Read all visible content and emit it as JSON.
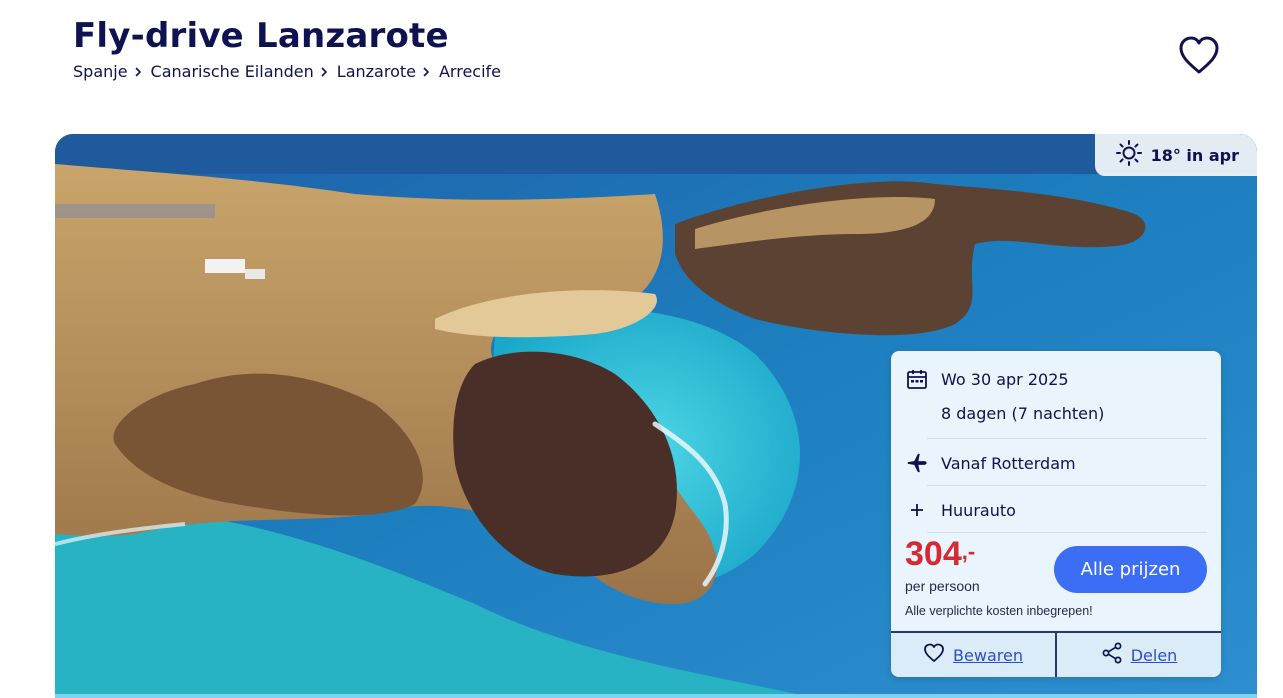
{
  "header": {
    "title": "Fly-drive Lanzarote",
    "breadcrumb": [
      "Spanje",
      "Canarische Eilanden",
      "Lanzarote",
      "Arrecife"
    ]
  },
  "hero": {
    "weather": "18° in apr",
    "image_subject": "Aerial coastline with turquoise sea and cliffs"
  },
  "card": {
    "date": "Wo 30 apr 2025",
    "duration": "8 dagen (7 nachten)",
    "departure": "Vanaf Rotterdam",
    "extra": "Huurauto",
    "price_main": "304",
    "price_suffix": ",-",
    "price_unit": "per persoon",
    "costs_note": "Alle verplichte kosten inbegrepen!",
    "cta": "Alle prijzen",
    "save": "Bewaren",
    "share": "Delen"
  },
  "colors": {
    "title": "#0f1250",
    "price": "#d52a34",
    "cta": "#3b6df5",
    "link": "#2a50c9",
    "card_bg": "#eaf4fd"
  },
  "icons": [
    "heart-icon",
    "sun-icon",
    "calendar-icon",
    "plane-icon",
    "plus-icon",
    "share-icon",
    "chevron-right-icon"
  ]
}
